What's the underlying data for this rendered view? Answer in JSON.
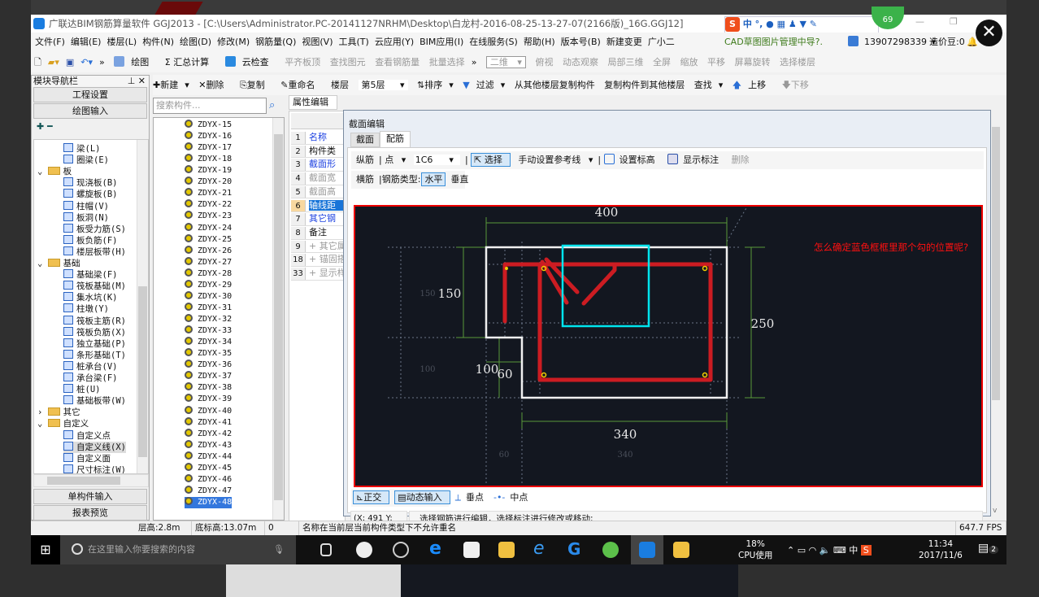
{
  "window": {
    "title": "广联达BIM钢筋算量软件 GGJ2013 - [C:\\Users\\Administrator.PC-20141127NRHM\\Desktop\\白龙村-2016-08-25-13-27-07(2166版)_16G.GGJ12]"
  },
  "ime_bar": {
    "items": [
      "中",
      "°,",
      "mic",
      "keyboard",
      "user",
      "shirt",
      "wrench"
    ]
  },
  "badge": "69",
  "menu": [
    "文件(F)",
    "编辑(E)",
    "楼层(L)",
    "构件(N)",
    "绘图(D)",
    "修改(M)",
    "钢筋量(Q)",
    "视图(V)",
    "工具(T)",
    "云应用(Y)",
    "BIM应用(I)",
    "在线服务(S)",
    "帮助(H)",
    "版本号(B)",
    "新建变更",
    "广小二"
  ],
  "menu_right": {
    "cad": "CAD草图图片管理中导?.",
    "phone": "13907298339",
    "beans": "造价豆:0"
  },
  "toolbar1": {
    "items": [
      "绘图",
      "汇总计算",
      "云检查",
      "平齐板顶",
      "查找图元",
      "查看钢筋量",
      "批量选择"
    ],
    "view_select": "二维",
    "view_items": [
      "俯视",
      "动态观察",
      "局部三维",
      "全屏",
      "缩放",
      "平移",
      "屏幕旋转",
      "选择楼层"
    ]
  },
  "toolbar2": {
    "items": [
      "新建",
      "删除",
      "复制",
      "重命名"
    ],
    "floor_label": "楼层",
    "floor_value": "第5层",
    "items2": [
      "排序",
      "过滤",
      "从其他楼层复制构件",
      "复制构件到其他楼层",
      "查找",
      "上移",
      "下移"
    ]
  },
  "nav": {
    "title": "模块导航栏",
    "btn_project": "工程设置",
    "btn_draw": "绘图输入",
    "btn_single": "单构件输入",
    "btn_report": "报表预览",
    "tree": [
      {
        "label": "梁(L)",
        "level": 2
      },
      {
        "label": "圈梁(E)",
        "level": 2
      },
      {
        "label": "板",
        "level": 1,
        "folder": true,
        "open": true
      },
      {
        "label": "现浇板(B)",
        "level": 2
      },
      {
        "label": "螺旋板(B)",
        "level": 2
      },
      {
        "label": "柱帽(V)",
        "level": 2
      },
      {
        "label": "板洞(N)",
        "level": 2
      },
      {
        "label": "板受力筋(S)",
        "level": 2
      },
      {
        "label": "板负筋(F)",
        "level": 2
      },
      {
        "label": "楼层板带(H)",
        "level": 2
      },
      {
        "label": "基础",
        "level": 1,
        "folder": true,
        "open": true
      },
      {
        "label": "基础梁(F)",
        "level": 2
      },
      {
        "label": "筏板基础(M)",
        "level": 2
      },
      {
        "label": "集水坑(K)",
        "level": 2
      },
      {
        "label": "柱墩(Y)",
        "level": 2
      },
      {
        "label": "筏板主筋(R)",
        "level": 2
      },
      {
        "label": "筏板负筋(X)",
        "level": 2
      },
      {
        "label": "独立基础(P)",
        "level": 2
      },
      {
        "label": "条形基础(T)",
        "level": 2
      },
      {
        "label": "桩承台(V)",
        "level": 2
      },
      {
        "label": "承台梁(F)",
        "level": 2
      },
      {
        "label": "桩(U)",
        "level": 2
      },
      {
        "label": "基础板带(W)",
        "level": 2
      },
      {
        "label": "其它",
        "level": 1,
        "folder": true,
        "open": false
      },
      {
        "label": "自定义",
        "level": 1,
        "folder": true,
        "open": true
      },
      {
        "label": "自定义点",
        "level": 2
      },
      {
        "label": "自定义线(X)",
        "level": 2,
        "selected": true
      },
      {
        "label": "自定义面",
        "level": 2
      },
      {
        "label": "尺寸标注(W)",
        "level": 2
      }
    ]
  },
  "components": {
    "search_placeholder": "搜索构件...",
    "items": [
      "ZDYX-15",
      "ZDYX-16",
      "ZDYX-17",
      "ZDYX-18",
      "ZDYX-19",
      "ZDYX-20",
      "ZDYX-21",
      "ZDYX-22",
      "ZDYX-23",
      "ZDYX-24",
      "ZDYX-25",
      "ZDYX-26",
      "ZDYX-27",
      "ZDYX-28",
      "ZDYX-29",
      "ZDYX-30",
      "ZDYX-31",
      "ZDYX-32",
      "ZDYX-33",
      "ZDYX-34",
      "ZDYX-35",
      "ZDYX-36",
      "ZDYX-37",
      "ZDYX-38",
      "ZDYX-39",
      "ZDYX-40",
      "ZDYX-41",
      "ZDYX-42",
      "ZDYX-43",
      "ZDYX-44",
      "ZDYX-45",
      "ZDYX-46",
      "ZDYX-47",
      "ZDYX-48"
    ],
    "selected": "ZDYX-48"
  },
  "props": {
    "tab": "属性编辑",
    "rows": [
      {
        "n": "1",
        "t": "名称",
        "c": "blue"
      },
      {
        "n": "2",
        "t": "构件类",
        "c": "black"
      },
      {
        "n": "3",
        "t": "截面形",
        "c": "blue"
      },
      {
        "n": "4",
        "t": "截面宽",
        "c": "gray"
      },
      {
        "n": "5",
        "t": "截面高",
        "c": "gray"
      },
      {
        "n": "6",
        "t": "轴线距",
        "c": "selected"
      },
      {
        "n": "7",
        "t": "其它钢",
        "c": "blue"
      },
      {
        "n": "8",
        "t": "备注",
        "c": "black"
      },
      {
        "n": "9",
        "t": "+ 其它属",
        "c": "gray"
      },
      {
        "n": "18",
        "t": "+ 锚固搭",
        "c": "gray"
      },
      {
        "n": "33",
        "t": "+ 显示样",
        "c": "gray"
      }
    ]
  },
  "dialog": {
    "title": "截面编辑",
    "tabs": [
      "截面",
      "配筋"
    ],
    "active_tab": "配筋",
    "row1": {
      "label": "纵筋",
      "mode": "点",
      "spec": "1C6",
      "select": "选择",
      "ref": "手动设置参考线",
      "elev": "设置标高",
      "show": "显示标注",
      "del": "删除"
    },
    "row2": {
      "label": "横筋",
      "type_label": "钢筋类型:",
      "horizontal": "水平",
      "vertical": "垂直"
    },
    "bottom": {
      "ortho": "正交",
      "dyn": "动态输入",
      "perp": "垂点",
      "mid": "中点"
    },
    "coords": "(X: 491 Y: 197)",
    "hint": "选择钢筋进行编辑，选择标注进行修改或移动;",
    "dims": {
      "top": "400",
      "left": "150",
      "right": "250",
      "bottom": "340",
      "step_w": "100",
      "step_h": "60",
      "faint": [
        "150",
        "100",
        "60",
        "340"
      ]
    },
    "question": "怎么确定蓝色框框里那个勾的位置呢?",
    "colors": {
      "rebar": "#cc1c22",
      "outline": "#f0f0f0",
      "highlight": "#00e5ee",
      "dim": "#5a9a3a",
      "bg": "#131720"
    }
  },
  "statusbar": {
    "floor_h": "层高:2.8m",
    "base_h": "底标高:13.07m",
    "val": "0",
    "msg": "名称在当前层当前构件类型下不允许重名",
    "fps": "647.7 FPS"
  },
  "taskbar": {
    "search": "在这里输入你要搜索的内容",
    "cpu": "18%",
    "cpu_label": "CPU使用",
    "ime": "中",
    "time": "11:34",
    "date": "2017/11/6",
    "notif": "2"
  }
}
